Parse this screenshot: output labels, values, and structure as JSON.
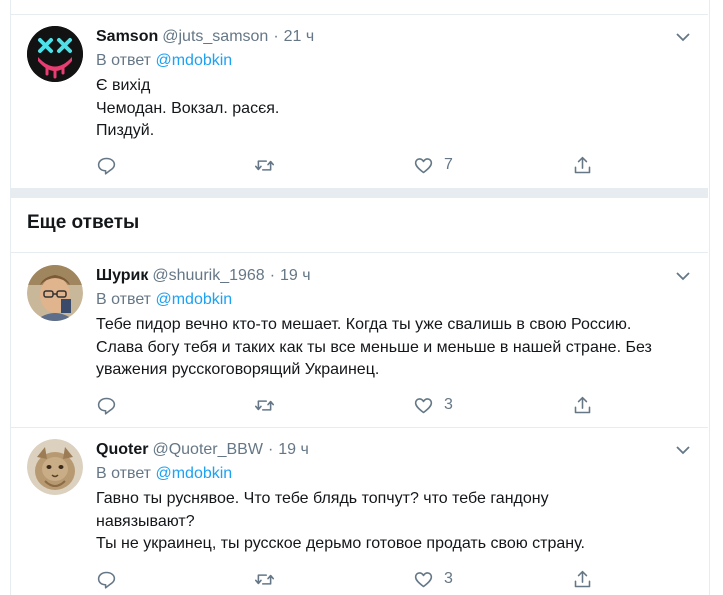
{
  "replies": [
    {
      "name": "Samson",
      "handle": "@juts_samson",
      "dot": "·",
      "time": "21 ч",
      "reply_prefix": "В ответ",
      "reply_to": "@mdobkin",
      "lines": [
        "Є вихід",
        "Чемодан. Вокзал. расєя.",
        "Пиздуй."
      ],
      "likes": "7"
    },
    {
      "name": "Шурик",
      "handle": "@shuurik_1968",
      "dot": "·",
      "time": "19 ч",
      "reply_prefix": "В ответ",
      "reply_to": "@mdobkin",
      "lines": [
        "Тебе пидор вечно кто-то мешает. Когда ты уже свалишь в свою Россию.",
        "Слава богу тебя и таких как ты все меньше и меньше в нашей стране. Без",
        "уважения русскоговорящий Украинец."
      ],
      "likes": "3"
    },
    {
      "name": "Quoter",
      "handle": "@Quoter_BBW",
      "dot": "·",
      "time": "19 ч",
      "reply_prefix": "В ответ",
      "reply_to": "@mdobkin",
      "lines": [
        "Гавно ты руснявое. Что тебе блядь топчут? что тебе гандону",
        "навязывают?",
        "Ты не украинец, ты русское дерьмо готовое продать свою страну."
      ],
      "likes": "3"
    }
  ],
  "section": {
    "title": "Еще ответы"
  },
  "icons": {
    "reply": "reply-icon",
    "retweet": "retweet-icon",
    "like": "heart-icon",
    "share": "share-icon",
    "caret": "chevron-down-icon"
  },
  "colors": {
    "accent": "#1da1f2",
    "muted": "#657786",
    "border": "#e6ecf0",
    "text": "#14171a"
  }
}
